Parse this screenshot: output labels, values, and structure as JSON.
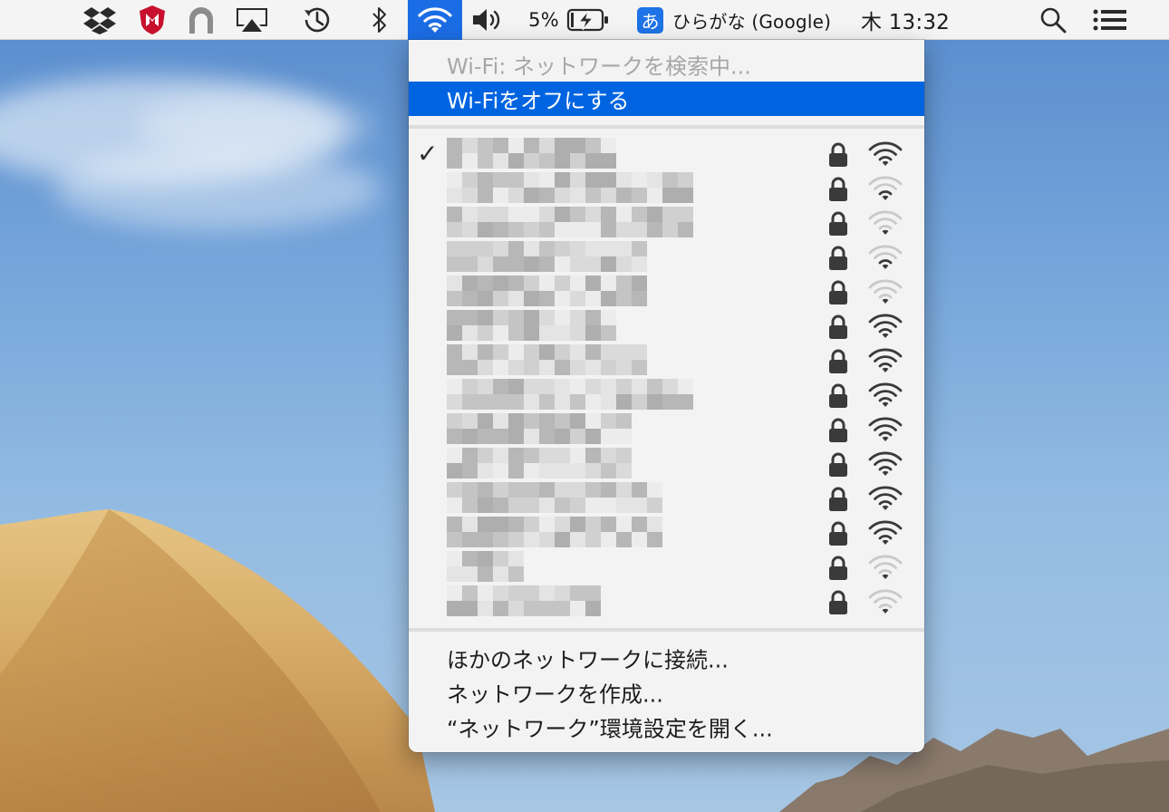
{
  "menubar": {
    "icons": [
      "dropbox-icon",
      "mcafee-icon",
      "arch-app-icon",
      "airplay-icon",
      "time-machine-icon",
      "bluetooth-icon",
      "wifi-icon",
      "volume-icon"
    ],
    "battery_percent": "5%",
    "input_method_badge": "あ",
    "input_method_label": "ひらがな (Google)",
    "clock": "木 13:32"
  },
  "wifi_menu": {
    "status": "Wi-Fi: ネットワークを検索中...",
    "turn_off": "Wi-Fiをオフにする",
    "networks": [
      {
        "name_redacted": true,
        "connected": true,
        "secured": true,
        "signal_bars": 4
      },
      {
        "name_redacted": true,
        "connected": false,
        "secured": true,
        "signal_bars": 2
      },
      {
        "name_redacted": true,
        "connected": false,
        "secured": true,
        "signal_bars": 1
      },
      {
        "name_redacted": true,
        "connected": false,
        "secured": true,
        "signal_bars": 2
      },
      {
        "name_redacted": true,
        "connected": false,
        "secured": true,
        "signal_bars": 1
      },
      {
        "name_redacted": true,
        "connected": false,
        "secured": true,
        "signal_bars": 4
      },
      {
        "name_redacted": true,
        "connected": false,
        "secured": true,
        "signal_bars": 4
      },
      {
        "name_redacted": true,
        "connected": false,
        "secured": true,
        "signal_bars": 4
      },
      {
        "name_redacted": true,
        "connected": false,
        "secured": true,
        "signal_bars": 4
      },
      {
        "name_redacted": true,
        "connected": false,
        "secured": true,
        "signal_bars": 4
      },
      {
        "name_redacted": true,
        "connected": false,
        "secured": true,
        "signal_bars": 4
      },
      {
        "name_redacted": true,
        "connected": false,
        "secured": true,
        "signal_bars": 4
      },
      {
        "name_redacted": true,
        "connected": false,
        "secured": true,
        "signal_bars": 1
      },
      {
        "name_redacted": true,
        "connected": false,
        "secured": true,
        "signal_bars": 1
      }
    ],
    "join_other": "ほかのネットワークに接続...",
    "create_network": "ネットワークを作成...",
    "open_prefs": "“ネットワーク”環境設定を開く..."
  },
  "colors": {
    "accent": "#0064e1",
    "menubar_bg": "#f4f4f4",
    "menu_bg": "#f3f3f3",
    "disabled_text": "#a7a7a7"
  }
}
